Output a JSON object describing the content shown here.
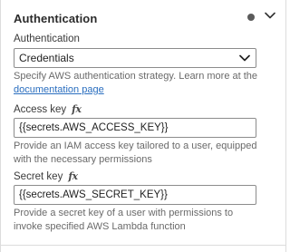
{
  "section": {
    "title": "Authentication"
  },
  "auth": {
    "label": "Authentication",
    "selected": "Credentials",
    "help_prefix": "Specify AWS authentication strategy. Learn more at the ",
    "help_link": "documentation page"
  },
  "access_key": {
    "label": "Access key",
    "fx": "fx",
    "value": "{{secrets.AWS_ACCESS_KEY}}",
    "help": "Provide an IAM access key tailored to a user, equipped with the necessary permissions"
  },
  "secret_key": {
    "label": "Secret key",
    "fx": "fx",
    "value": "{{secrets.AWS_SECRET_KEY}}",
    "help": "Provide a secret key of a user with permissions to invoke specified AWS Lambda function"
  },
  "icons": {
    "status": "status-dot-icon",
    "collapse": "chevron-down-icon",
    "select_arrow": "chevron-down-icon",
    "expression": "fx-icon"
  },
  "colors": {
    "link": "#2a6ebf",
    "border": "#8c8c8c",
    "help_text": "#6a6a6a",
    "status_dot": "#5b5b5b"
  }
}
